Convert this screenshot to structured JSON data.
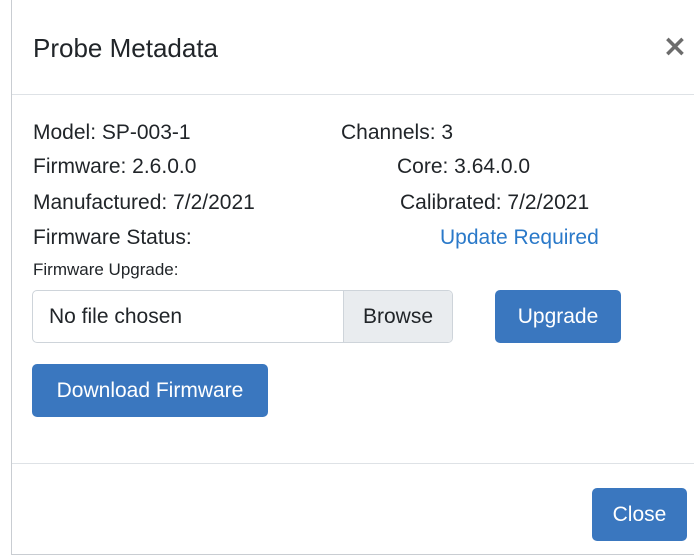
{
  "header": {
    "title": "Probe Metadata",
    "close_glyph": "×"
  },
  "info": {
    "model": "Model: SP-003-1",
    "channels": "Channels: 3",
    "firmware": "Firmware: 2.6.0.0",
    "core": "Core: 3.64.0.0",
    "manufactured": "Manufactured: 7/2/2021",
    "calibrated": "Calibrated: 7/2/2021",
    "firmware_status_label": "Firmware Status:",
    "firmware_status_value": "Update Required",
    "firmware_upgrade_label": "Firmware Upgrade:"
  },
  "file_input": {
    "value": "No file chosen",
    "browse_label": "Browse"
  },
  "buttons": {
    "upgrade": "Upgrade",
    "download_firmware": "Download Firmware",
    "close": "Close"
  },
  "colors": {
    "primary": "#3a77bf",
    "link": "#2a79c9",
    "text": "#212529",
    "input_addon_bg": "#e9ecef"
  }
}
